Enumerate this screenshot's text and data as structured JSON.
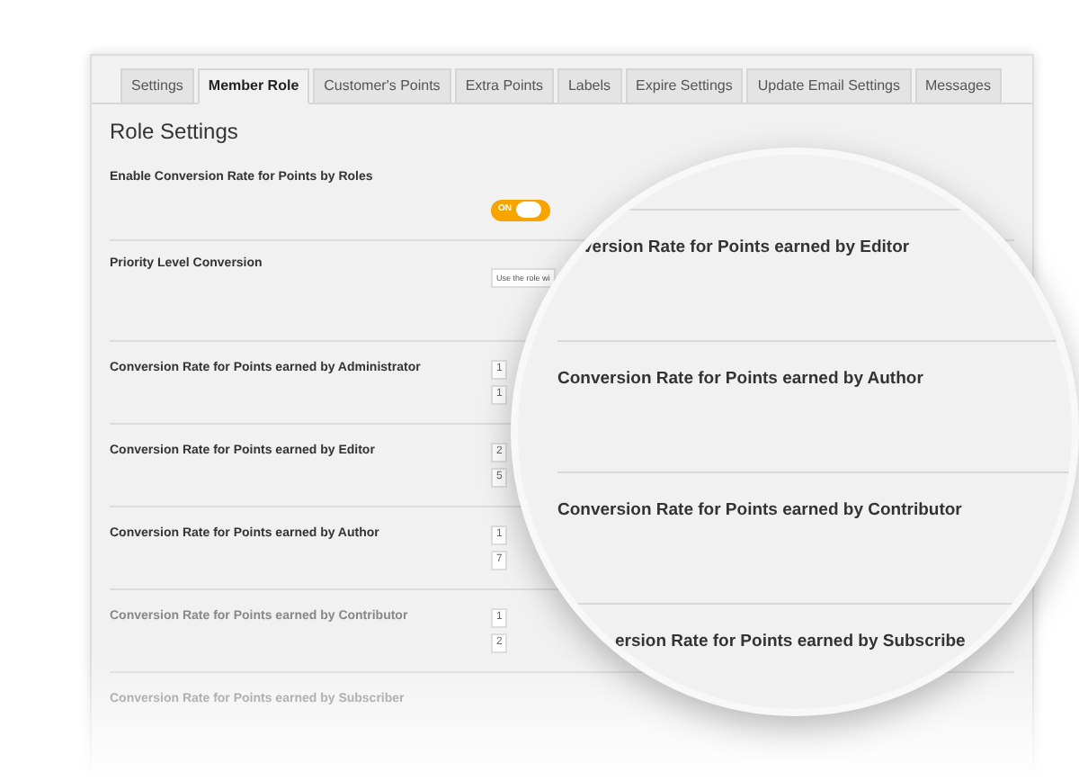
{
  "tabs": [
    {
      "label": "Settings",
      "selected": false
    },
    {
      "label": "Member Role",
      "selected": true
    },
    {
      "label": "Customer's Points",
      "selected": false
    },
    {
      "label": "Extra Points",
      "selected": false
    },
    {
      "label": "Labels",
      "selected": false
    },
    {
      "label": "Expire Settings",
      "selected": false
    },
    {
      "label": "Update Email Settings",
      "selected": false
    },
    {
      "label": "Messages",
      "selected": false
    }
  ],
  "section_title": "Role Settings",
  "toggle_row": {
    "label": "Enable Conversion Rate for Points by Roles",
    "on": true,
    "on_label": "ON"
  },
  "priority_row": {
    "label": "Priority Level Conversion",
    "value": "Use the role wi"
  },
  "rate_rows": [
    {
      "label": "Conversion Rate for Points earned by Administrator",
      "values": [
        "1",
        "1"
      ]
    },
    {
      "label": "Conversion Rate for Points earned by Editor",
      "values": [
        "2",
        "5"
      ]
    },
    {
      "label": "Conversion Rate for Points earned by Author",
      "values": [
        "1",
        "7"
      ]
    },
    {
      "label": "Conversion Rate for Points earned by Contributor",
      "values": [
        "1",
        "2"
      ]
    },
    {
      "label": "Conversion Rate for Points earned by Subscriber",
      "values": []
    }
  ],
  "magnifier": {
    "rows": [
      {
        "label": "version Rate for Points earned by Editor"
      },
      {
        "label": "Conversion Rate for Points earned by Author"
      },
      {
        "label": "Conversion Rate for Points earned by Contributor"
      },
      {
        "label": "ersion Rate for Points earned by Subscribe"
      }
    ]
  }
}
